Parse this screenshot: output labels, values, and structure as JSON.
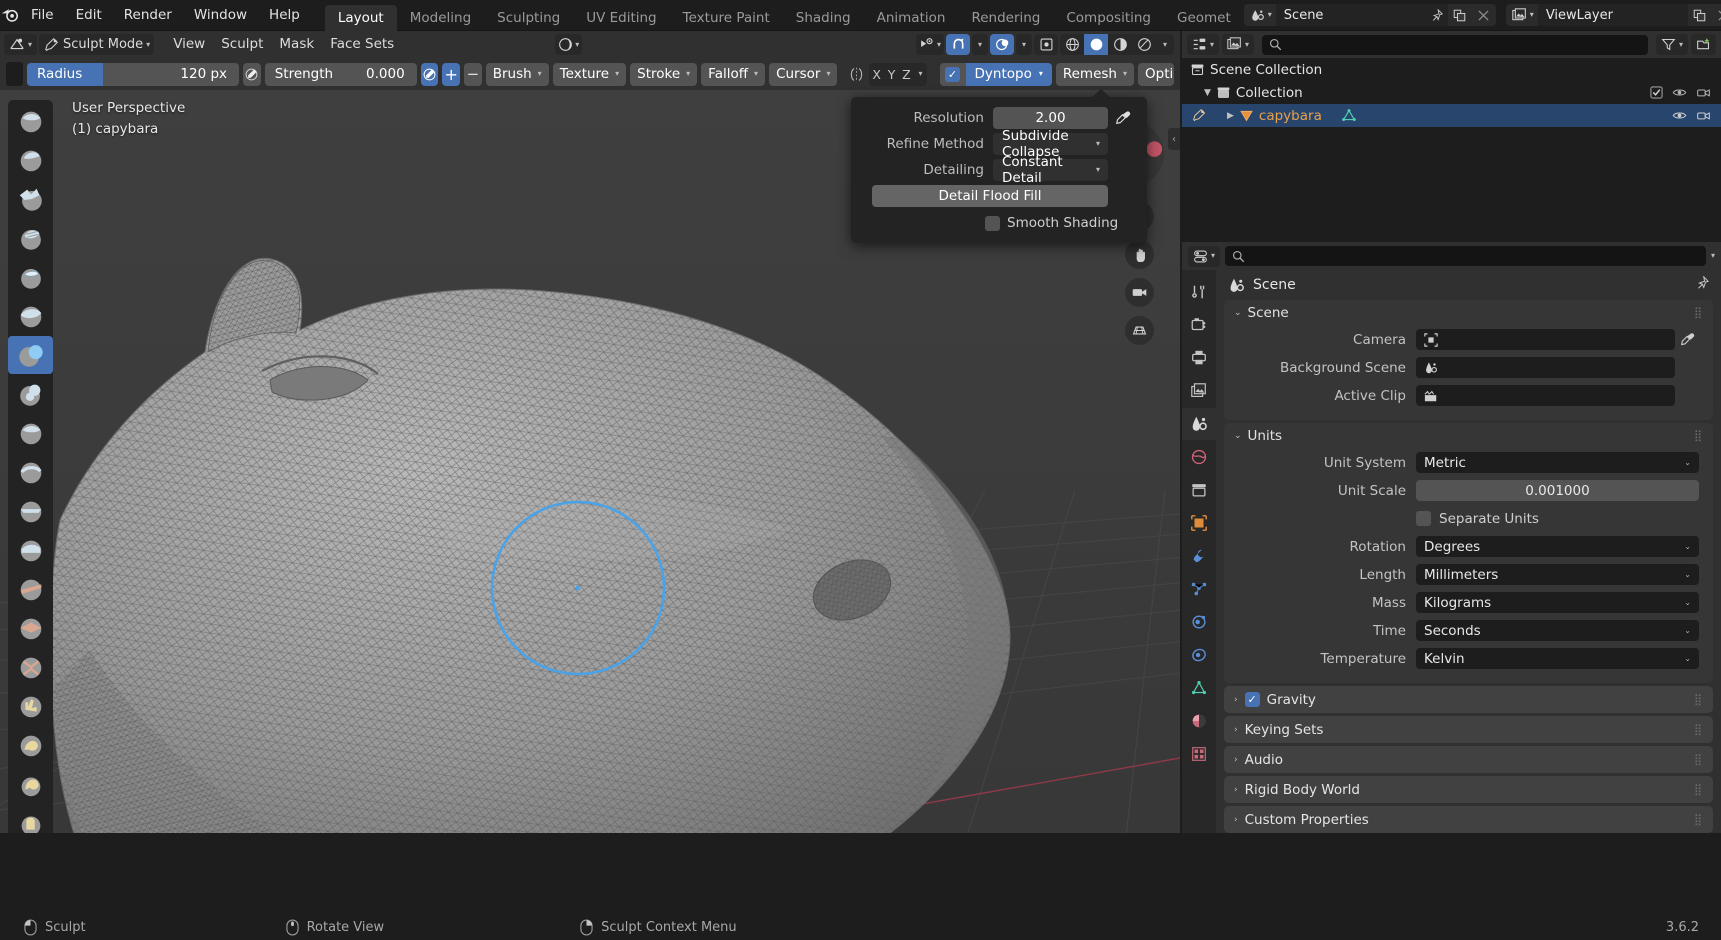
{
  "app": {
    "version": "3.6.2",
    "accent_blue": "#4772b3",
    "selection_blue": "#28456e",
    "header_bg": "#303030",
    "panel_bg": "#363636",
    "viewport_bg": "#3b3b3b"
  },
  "topbar": {
    "logo_icon": "blender-logo-icon",
    "menus": [
      "File",
      "Edit",
      "Render",
      "Window",
      "Help"
    ],
    "workspaces": [
      {
        "label": "Layout",
        "active": true
      },
      {
        "label": "Modeling",
        "active": false
      },
      {
        "label": "Sculpting",
        "active": false
      },
      {
        "label": "UV Editing",
        "active": false
      },
      {
        "label": "Texture Paint",
        "active": false
      },
      {
        "label": "Shading",
        "active": false
      },
      {
        "label": "Animation",
        "active": false
      },
      {
        "label": "Rendering",
        "active": false
      },
      {
        "label": "Compositing",
        "active": false
      },
      {
        "label": "Geomet",
        "active": false
      }
    ],
    "scene": {
      "icon": "scene-icon",
      "name": "Scene",
      "pin_icon": "pin-icon",
      "copy_icon": "duplicate-icon",
      "close_icon": "x-icon"
    },
    "viewlayer": {
      "icon": "viewlayer-icon",
      "name": "ViewLayer",
      "copy_icon": "duplicate-icon",
      "close_icon": "x-icon"
    }
  },
  "tool_header": {
    "editor_type_icon": "editor-type-3dview-icon",
    "mode": "Sculpt Mode",
    "menus": [
      "View",
      "Sculpt",
      "Mask",
      "Face Sets"
    ],
    "shading_preview_icon": "shading-ball-icon",
    "right_icons": [
      {
        "name": "visibility-selectability-icon",
        "active": false
      },
      {
        "name": "snap-magnet-icon",
        "active": true
      },
      {
        "name": "proportional-editing-icon",
        "active": true
      },
      {
        "name": "show-gizmo-icon",
        "active": false
      },
      {
        "name": "shading-wireframe-icon",
        "active": false
      },
      {
        "name": "shading-solid-icon",
        "active": true
      },
      {
        "name": "shading-material-icon",
        "active": false
      },
      {
        "name": "shading-rendered-icon",
        "active": false
      }
    ]
  },
  "brush_header": {
    "brush_preview_icon": "brush-preview-icon",
    "radius": {
      "label": "Radius",
      "value": "120 px",
      "fill_percent": 36,
      "pressure_icon": "pressure-icon"
    },
    "strength": {
      "label": "Strength",
      "value": "0.000",
      "pressure_icon": "pressure-icon"
    },
    "add_label": "+",
    "subtract_label": "−",
    "dropdowns": [
      "Brush",
      "Texture",
      "Stroke",
      "Falloff",
      "Cursor"
    ],
    "symmetry_icon": "symmetry-icon",
    "axes": [
      "X",
      "Y",
      "Z"
    ],
    "dyntopo": {
      "label": "Dyntopo",
      "enabled": true
    },
    "remesh_label": "Remesh",
    "options_label": "Option"
  },
  "viewport": {
    "overlay_line1": "User Perspective",
    "overlay_line2": "(1) capybara",
    "toolbar_tools": [
      {
        "name": "tool-draw",
        "active": false
      },
      {
        "name": "tool-draw-sharp",
        "active": false
      },
      {
        "name": "tool-clay",
        "active": false
      },
      {
        "name": "tool-clay-strips",
        "active": false
      },
      {
        "name": "tool-clay-thumb",
        "active": false
      },
      {
        "name": "tool-layer",
        "active": false
      },
      {
        "name": "tool-inflate",
        "active": true
      },
      {
        "name": "tool-blob",
        "active": false
      },
      {
        "name": "tool-crease",
        "active": false
      },
      {
        "name": "tool-smooth",
        "active": false
      },
      {
        "name": "tool-flatten",
        "active": false
      },
      {
        "name": "tool-fill",
        "active": false
      },
      {
        "name": "tool-scrape",
        "active": false
      },
      {
        "name": "tool-multiplane-scrape",
        "active": false
      },
      {
        "name": "tool-pinch",
        "active": false
      },
      {
        "name": "tool-grab",
        "active": false
      },
      {
        "name": "tool-elastic-deform",
        "active": false
      },
      {
        "name": "tool-snake-hook",
        "active": false
      },
      {
        "name": "tool-thumb",
        "active": false
      },
      {
        "name": "tool-pose",
        "active": false
      },
      {
        "name": "tool-nudge",
        "active": false
      }
    ],
    "nav_buttons": [
      {
        "name": "zoom-region-icon"
      },
      {
        "name": "pan-view-icon"
      },
      {
        "name": "camera-view-icon"
      },
      {
        "name": "toggle-perspective-icon"
      }
    ],
    "brush_cursor": {
      "name": "brush-circle-cursor",
      "radius_px": 85
    }
  },
  "dyntopo_popup": {
    "resolution": {
      "label": "Resolution",
      "value": "2.00",
      "eyedropper_icon": "eyedropper-icon"
    },
    "refine_method": {
      "label": "Refine Method",
      "value": "Subdivide Collapse"
    },
    "detailing": {
      "label": "Detailing",
      "value": "Constant Detail"
    },
    "flood_fill_button": "Detail Flood Fill",
    "smooth_shading": {
      "label": "Smooth Shading",
      "checked": false
    }
  },
  "outliner": {
    "header": {
      "display_mode_icon": "outliner-display-mode-icon",
      "filter_id_icon": "filter-id-icon",
      "search_icon": "search-icon",
      "search_placeholder": "",
      "filter_icon": "funnel-icon",
      "new_collection_icon": "new-collection-icon"
    },
    "rows": [
      {
        "label": "Scene Collection",
        "icon": "collection-icon",
        "indent": 0,
        "selected": false,
        "expander": "",
        "right_icons": []
      },
      {
        "label": "Collection",
        "icon": "collection-icon",
        "indent": 1,
        "selected": false,
        "expander": "▼",
        "right_icons": [
          "checkbox-icon",
          "eye-icon",
          "camera-icon"
        ]
      },
      {
        "label": "capybara",
        "icon": "mesh-object-icon",
        "indent": 2,
        "selected": true,
        "expander": "▶",
        "right_icons": [
          "eye-icon",
          "camera-icon"
        ],
        "data_icon": "mesh-data-icon",
        "mode_icon": "sculpt-mode-icon"
      }
    ]
  },
  "properties": {
    "header": {
      "editor_type_icon": "editor-type-properties-icon",
      "search_icon": "search-icon",
      "search_placeholder": ""
    },
    "tabs": [
      {
        "name": "tool-tab",
        "active": false
      },
      {
        "name": "render-tab",
        "active": false
      },
      {
        "name": "output-tab",
        "active": false
      },
      {
        "name": "viewlayer-tab",
        "active": false
      },
      {
        "name": "scene-tab",
        "active": true
      },
      {
        "name": "world-tab",
        "active": false
      },
      {
        "name": "collection-tab",
        "active": false
      },
      {
        "name": "object-tab",
        "active": false
      },
      {
        "name": "modifiers-tab",
        "active": false
      },
      {
        "name": "particles-tab",
        "active": false
      },
      {
        "name": "physics-tab",
        "active": false
      },
      {
        "name": "constraints-tab",
        "active": false
      },
      {
        "name": "data-tab",
        "active": false
      },
      {
        "name": "material-tab",
        "active": false
      },
      {
        "name": "texture-tab",
        "active": false
      }
    ],
    "breadcrumb": {
      "icon": "scene-icon",
      "label": "Scene"
    },
    "panels": [
      {
        "title": "Scene",
        "expanded": true,
        "rows": [
          {
            "label": "Camera",
            "value": "",
            "icon": "camera-object-icon",
            "eyedropper": true,
            "type": "id"
          },
          {
            "label": "Background Scene",
            "value": "",
            "icon": "scene-icon",
            "eyedropper": false,
            "type": "id"
          },
          {
            "label": "Active Clip",
            "value": "",
            "icon": "clip-icon",
            "eyedropper": false,
            "type": "id"
          }
        ]
      },
      {
        "title": "Units",
        "expanded": true,
        "rows": [
          {
            "label": "Unit System",
            "value": "Metric",
            "type": "dropdown"
          },
          {
            "label": "Unit Scale",
            "value": "0.001000",
            "type": "number"
          },
          {
            "label": "Separate Units",
            "value": "",
            "type": "checkbox",
            "checked": false
          },
          {
            "label": "Rotation",
            "value": "Degrees",
            "type": "dropdown"
          },
          {
            "label": "Length",
            "value": "Millimeters",
            "type": "dropdown"
          },
          {
            "label": "Mass",
            "value": "Kilograms",
            "type": "dropdown"
          },
          {
            "label": "Time",
            "value": "Seconds",
            "type": "dropdown"
          },
          {
            "label": "Temperature",
            "value": "Kelvin",
            "type": "dropdown"
          }
        ]
      }
    ],
    "collapsed_panels": [
      {
        "title": "Gravity",
        "checkbox": true,
        "checked": true
      },
      {
        "title": "Keying Sets",
        "checkbox": false,
        "checked": false
      },
      {
        "title": "Audio",
        "checkbox": false,
        "checked": false
      },
      {
        "title": "Rigid Body World",
        "checkbox": false,
        "checked": false
      },
      {
        "title": "Custom Properties",
        "checkbox": false,
        "checked": false
      }
    ]
  },
  "statusbar": {
    "items": [
      {
        "icon": "mouse-left-icon",
        "label": "Sculpt"
      },
      {
        "icon": "mouse-middle-icon",
        "label": "Rotate View"
      },
      {
        "icon": "mouse-right-icon",
        "label": "Sculpt Context Menu"
      }
    ],
    "version": "3.6.2"
  }
}
